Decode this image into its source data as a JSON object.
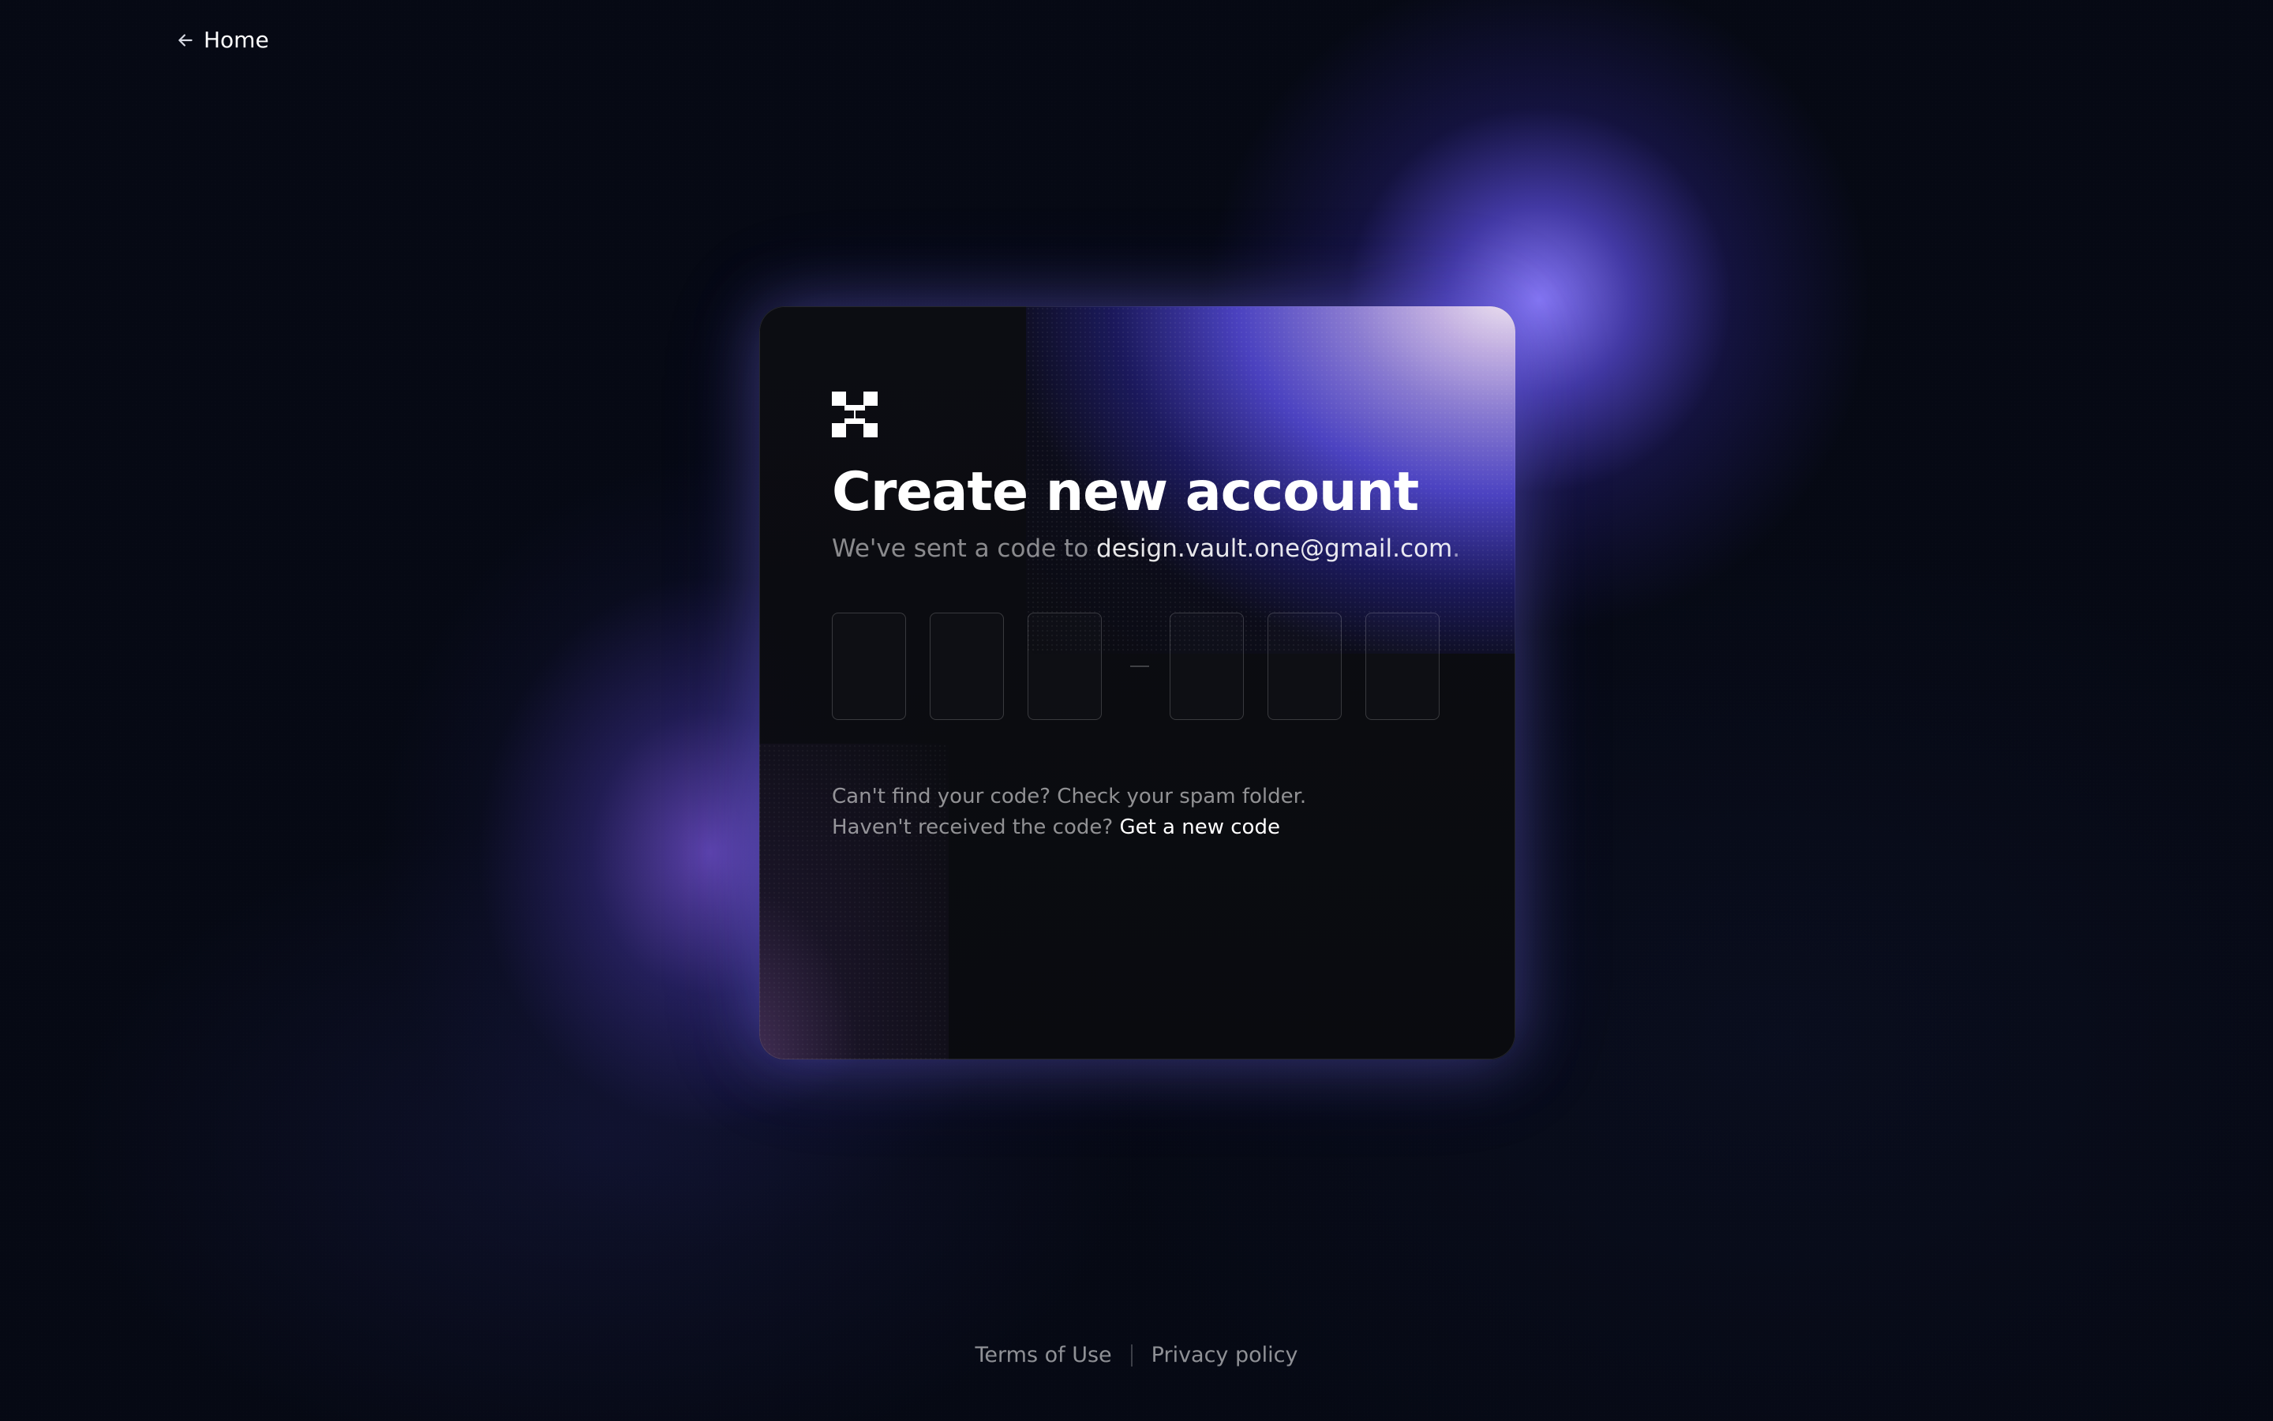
{
  "nav": {
    "home_label": "Home"
  },
  "card": {
    "title": "Create new account",
    "subtitle_prefix": "We've sent a code to",
    "email": "design.vault.one@gmail.com",
    "subtitle_suffix": ".",
    "help_line_1": "Can't find your code? Check your spam folder.",
    "help_line_2_prefix": "Haven't received the code?",
    "help_link": "Get a new code",
    "code_digits": [
      "",
      "",
      "",
      "",
      "",
      ""
    ]
  },
  "footer": {
    "terms": "Terms of Use",
    "privacy": "Privacy policy"
  },
  "colors": {
    "background": "#060914",
    "text_primary": "#ffffff",
    "text_secondary": "#8d919c",
    "accent_purple": "#6b5cff",
    "accent_glow": "#d7c9ff"
  },
  "icons": {
    "back": "arrow-left-icon",
    "logo": "brand-logo"
  }
}
